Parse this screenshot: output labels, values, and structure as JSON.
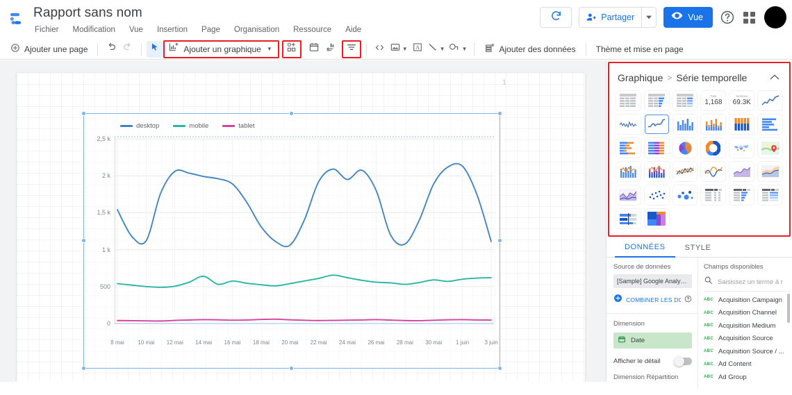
{
  "header": {
    "logo_icon": "looker-studio-logo",
    "doc_title": "Rapport sans nom",
    "menus": [
      "Fichier",
      "Modification",
      "Vue",
      "Insertion",
      "Page",
      "Organisation",
      "Ressource",
      "Aide"
    ],
    "refresh_icon": "refresh-icon",
    "share_label": "Partager",
    "share_icon": "person-add-icon",
    "share_caret_icon": "chevron-down-icon",
    "view_label": "Vue",
    "view_icon": "eye-icon",
    "help_icon": "help-circle-icon",
    "apps_icon": "apps-grid-icon",
    "avatar_icon": "user-avatar"
  },
  "toolbar": {
    "add_page_label": "Ajouter une page",
    "add_page_icon": "plus-circle-icon",
    "undo_icon": "undo-icon",
    "redo_icon": "redo-icon",
    "select_icon": "cursor-arrow-icon",
    "add_chart_label": "Ajouter un graphique",
    "add_chart_icon": "bar-chart-add-icon",
    "add_control_icon": "control-add-icon",
    "date_range_icon": "calendar-icon",
    "sort_icon": "sort-bars-icon",
    "filter_icon": "filter-icon",
    "embed_icon": "code-brackets-icon",
    "image_icon": "image-icon",
    "text_icon": "text-box-icon",
    "line_icon": "line-icon",
    "shape_icon": "shape-icon",
    "add_data_label": "Ajouter des données",
    "add_data_icon": "database-add-icon",
    "theme_label": "Thème et mise en page",
    "caret_icon": "chevron-down-icon"
  },
  "canvas": {
    "page_number": "1",
    "colors": {
      "selection": "#7ab3ef",
      "page_bg": "#ffffff",
      "canvas_bg": "#f1f3f4"
    }
  },
  "chart_data": {
    "type": "line",
    "title": "",
    "xlabel": "",
    "ylabel": "",
    "ylim": [
      0,
      2500
    ],
    "grid": true,
    "legend_position": "top",
    "y_ticks": [
      "0",
      "500",
      "1 k",
      "1,5 k",
      "2 k",
      "2,5 k"
    ],
    "y_tick_values": [
      0,
      500,
      1000,
      1500,
      2000,
      2500
    ],
    "x": [
      "8 mai",
      "9 mai",
      "10 mai",
      "11 mai",
      "12 mai",
      "13 mai",
      "14 mai",
      "15 mai",
      "16 mai",
      "17 mai",
      "18 mai",
      "19 mai",
      "20 mai",
      "21 mai",
      "22 mai",
      "23 mai",
      "24 mai",
      "25 mai",
      "26 mai",
      "27 mai",
      "28 mai",
      "29 mai",
      "30 mai",
      "31 mai",
      "1 juin",
      "2 juin",
      "3 juin"
    ],
    "x_tick_labels": [
      "8 mai",
      "10 mai",
      "12 mai",
      "14 mai",
      "16 mai",
      "18 mai",
      "20 mai",
      "22 mai",
      "24 mai",
      "26 mai",
      "28 mai",
      "30 mai",
      "1 juin",
      "3 juin"
    ],
    "series": [
      {
        "name": "desktop",
        "color": "#4285c5",
        "values": [
          1540,
          1180,
          1120,
          1760,
          2060,
          2035,
          1990,
          1960,
          1890,
          1640,
          1310,
          1110,
          1060,
          1400,
          1920,
          2090,
          1950,
          2075,
          1800,
          1200,
          1075,
          1400,
          1890,
          2120,
          2130,
          1750,
          1110
        ]
      },
      {
        "name": "mobile",
        "color": "#2ab5a5",
        "values": [
          540,
          520,
          500,
          490,
          505,
          560,
          640,
          530,
          575,
          545,
          525,
          510,
          540,
          575,
          610,
          655,
          620,
          585,
          560,
          550,
          530,
          555,
          590,
          570,
          600,
          615,
          620
        ]
      },
      {
        "name": "tablet",
        "color": "#d6409f",
        "values": [
          40,
          38,
          36,
          34,
          42,
          48,
          52,
          50,
          45,
          48,
          55,
          58,
          50,
          44,
          40,
          42,
          45,
          48,
          52,
          46,
          40,
          38,
          44,
          50,
          52,
          48,
          46
        ]
      }
    ]
  },
  "right_panel": {
    "gallery": {
      "breadcrumb_root": "Graphique",
      "breadcrumb_sep": ">",
      "breadcrumb_current": "Série temporelle",
      "collapse_icon": "chevron-up-icon",
      "highlight_color": "#ea1c24",
      "selected_cell": "time-series-line",
      "cells": [
        {
          "name": "table-chart",
          "icon": "table-icon"
        },
        {
          "name": "table-with-bars-chart",
          "icon": "table-bars-icon"
        },
        {
          "name": "table-with-heatmap-chart",
          "icon": "table-heatmap-icon"
        },
        {
          "name": "scorecard",
          "icon": "scorecard-icon",
          "label": "Total",
          "value": "1,168"
        },
        {
          "name": "scorecard-compact",
          "icon": "scorecard-icon",
          "label": "Sessions",
          "value": "69.3K"
        },
        {
          "name": "time-series-chart",
          "icon": "line-up-icon"
        },
        {
          "name": "sparkline-chart",
          "icon": "sparkline-icon"
        },
        {
          "name": "time-series-line",
          "icon": "line-smooth-icon"
        },
        {
          "name": "column-chart",
          "icon": "column-icon"
        },
        {
          "name": "stacked-column-chart",
          "icon": "stacked-column-icon"
        },
        {
          "name": "stacked-column-100-chart",
          "icon": "stacked-column-100-icon"
        },
        {
          "name": "bar-chart",
          "icon": "bar-icon"
        },
        {
          "name": "stacked-bar-chart",
          "icon": "stacked-bar-icon"
        },
        {
          "name": "stacked-bar-100-chart",
          "icon": "stacked-bar-100-icon"
        },
        {
          "name": "pie-chart",
          "icon": "pie-icon"
        },
        {
          "name": "donut-chart",
          "icon": "donut-icon"
        },
        {
          "name": "geo-map-chart",
          "icon": "world-map-icon"
        },
        {
          "name": "google-maps-chart",
          "icon": "map-pin-icon"
        },
        {
          "name": "combo-chart",
          "icon": "combo-icon"
        },
        {
          "name": "combo-stacked-chart",
          "icon": "combo-stacked-icon"
        },
        {
          "name": "line-chart",
          "icon": "line-multi-icon"
        },
        {
          "name": "smoothed-line-chart",
          "icon": "line-wave-icon"
        },
        {
          "name": "area-chart",
          "icon": "area-icon"
        },
        {
          "name": "stacked-area-chart",
          "icon": "stacked-area-icon"
        },
        {
          "name": "area-filled-chart",
          "icon": "area-filled-icon"
        },
        {
          "name": "scatter-chart",
          "icon": "scatter-icon"
        },
        {
          "name": "bubble-chart",
          "icon": "bubble-icon"
        },
        {
          "name": "pivot-table",
          "icon": "pivot-table-icon"
        },
        {
          "name": "pivot-table-bars",
          "icon": "pivot-bars-icon"
        },
        {
          "name": "pivot-table-heatmap",
          "icon": "pivot-heatmap-icon"
        },
        {
          "name": "bullet-chart",
          "icon": "bullet-icon"
        },
        {
          "name": "treemap-chart",
          "icon": "treemap-icon"
        }
      ]
    },
    "tabs": [
      {
        "label": "DONNÉES",
        "active": true
      },
      {
        "label": "STYLE",
        "active": false
      }
    ],
    "data_tab": {
      "data_source_label": "Source de données",
      "data_source_value": "[Sample] Google Analyti...",
      "combine_label": "COMBINER LES DONN",
      "combine_icon": "plus-circle-blue-icon",
      "combine_help_icon": "help-circle-icon",
      "dimension_label": "Dimension",
      "dimension_chips": [
        {
          "name": "Date",
          "icon": "calendar-green-icon"
        }
      ],
      "show_detail_label": "Afficher le détail",
      "show_detail_state": "off",
      "breakdown_label": "Dimension Répartition"
    },
    "fields": {
      "title": "Champs disponibles",
      "search_icon": "search-icon",
      "search_placeholder": "Saisissez un terme à r",
      "search_value": "",
      "items": [
        {
          "type": "ABC",
          "name": "Acquisition Campaign"
        },
        {
          "type": "ABC",
          "name": "Acquisition Channel"
        },
        {
          "type": "ABC",
          "name": "Acquisition Medium"
        },
        {
          "type": "ABC",
          "name": "Acquisition Source"
        },
        {
          "type": "ABC",
          "name": "Acquisition Source / ..."
        },
        {
          "type": "ABC",
          "name": "Ad Content"
        },
        {
          "type": "ABC",
          "name": "Ad Group"
        }
      ]
    }
  }
}
